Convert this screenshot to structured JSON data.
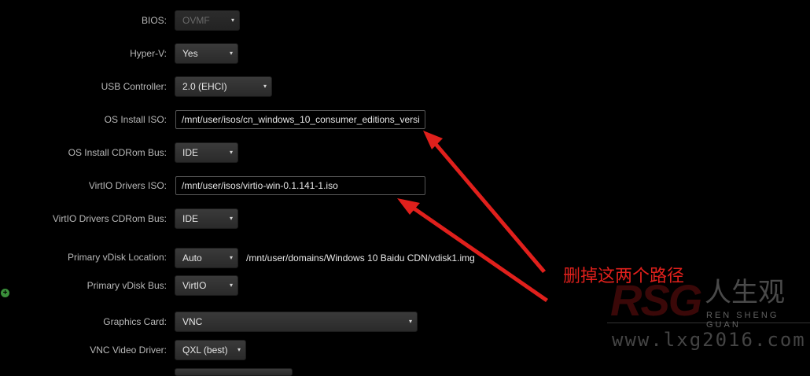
{
  "form": {
    "bios": {
      "label": "BIOS:",
      "value": "OVMF"
    },
    "hyperv": {
      "label": "Hyper-V:",
      "value": "Yes"
    },
    "usb_controller": {
      "label": "USB Controller:",
      "value": "2.0 (EHCI)"
    },
    "os_install_iso": {
      "label": "OS Install ISO:",
      "value": "/mnt/user/isos/cn_windows_10_consumer_editions_versi"
    },
    "os_install_cdrom_bus": {
      "label": "OS Install CDRom Bus:",
      "value": "IDE"
    },
    "virtio_drivers_iso": {
      "label": "VirtIO Drivers ISO:",
      "value": "/mnt/user/isos/virtio-win-0.1.141-1.iso"
    },
    "virtio_drivers_cdrom_bus": {
      "label": "VirtIO Drivers CDRom Bus:",
      "value": "IDE"
    },
    "primary_vdisk_location": {
      "label": "Primary vDisk Location:",
      "value": "Auto",
      "path": "/mnt/user/domains/Windows 10 Baidu CDN/vdisk1.img"
    },
    "primary_vdisk_bus": {
      "label": "Primary vDisk Bus:",
      "value": "VirtIO"
    },
    "graphics_card": {
      "label": "Graphics Card:",
      "value": "VNC"
    },
    "vnc_video_driver": {
      "label": "VNC Video Driver:",
      "value": "QXL (best)"
    }
  },
  "annotation": {
    "text": "删掉这两个路径",
    "color": "#e0201c"
  },
  "watermark": {
    "logo": "RSG",
    "chinese": "人生观",
    "pinyin": "REN SHENG GUAN",
    "url": "www.lxg2016.com"
  },
  "icons": {
    "caret": "▾",
    "add": "+"
  }
}
